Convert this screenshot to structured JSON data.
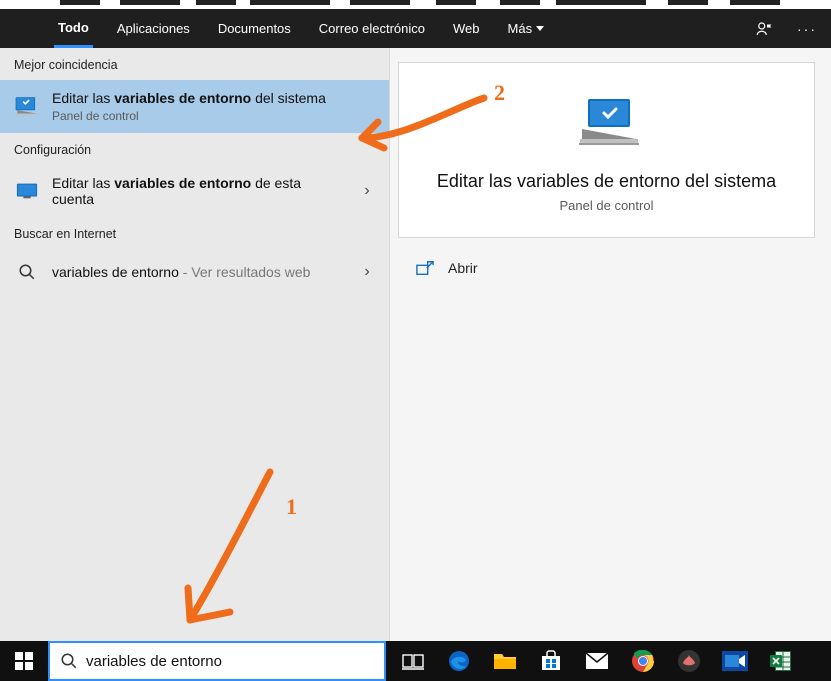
{
  "header": {
    "tabs": {
      "todo": "Todo",
      "aplicaciones": "Aplicaciones",
      "documentos": "Documentos",
      "correo": "Correo electrónico",
      "web": "Web",
      "mas": "Más"
    }
  },
  "sections": {
    "best_match": "Mejor coincidencia",
    "config": "Configuración",
    "internet": "Buscar en Internet"
  },
  "results": {
    "sys_env": {
      "pre": "Editar las ",
      "bold": "variables de entorno",
      "post": " del sistema",
      "sub": "Panel de control"
    },
    "user_env": {
      "pre": "Editar las ",
      "bold": "variables de entorno",
      "post": " de esta cuenta"
    },
    "web_search": {
      "text": "variables de entorno",
      "suffix": " - Ver resultados web"
    }
  },
  "preview": {
    "title": "Editar las variables de entorno del sistema",
    "sub": "Panel de control",
    "open": "Abrir"
  },
  "search": {
    "value": "variables de entorno"
  },
  "annotations": {
    "one": "1",
    "two": "2"
  }
}
